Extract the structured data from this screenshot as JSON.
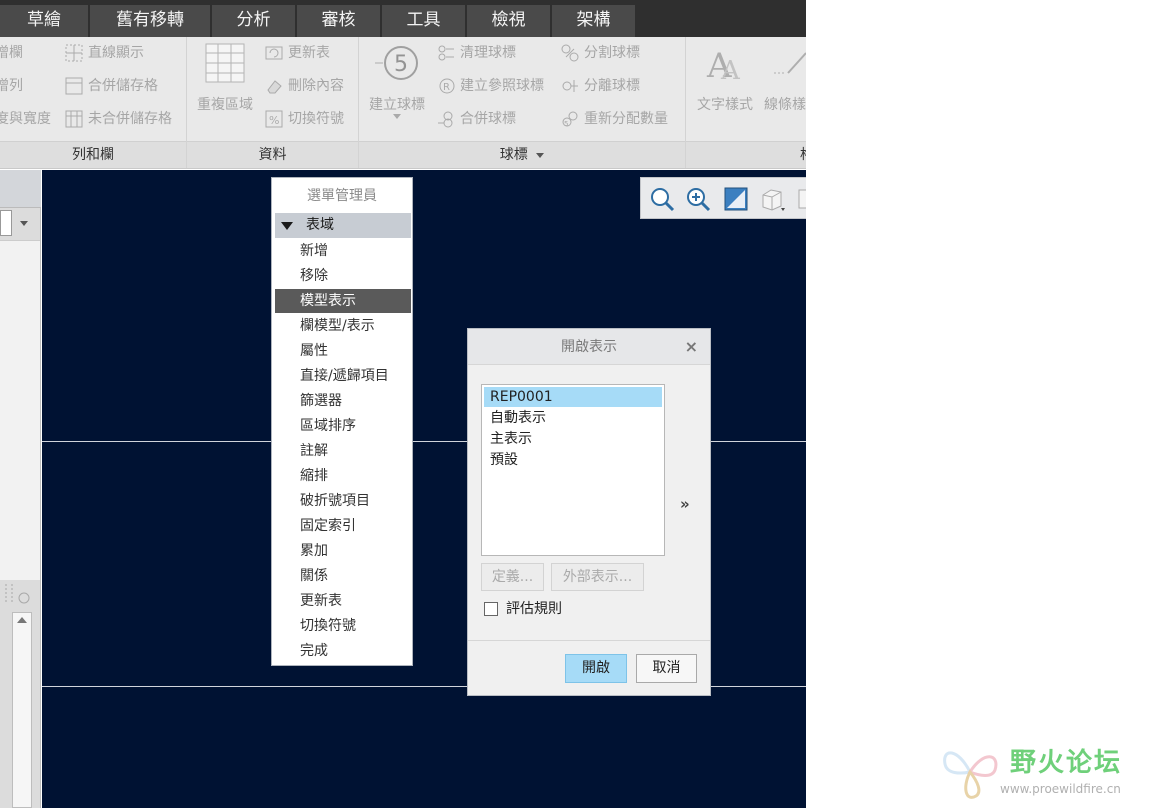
{
  "tabs": [
    {
      "label": "草繪"
    },
    {
      "label": "舊有移轉"
    },
    {
      "label": "分析"
    },
    {
      "label": "審核"
    },
    {
      "label": "工具"
    },
    {
      "label": "檢視"
    },
    {
      "label": "架構"
    }
  ],
  "ribbon": {
    "rows_cols": {
      "footer": "列和欄",
      "items": [
        "增欄",
        "增列",
        "度與寬度",
        "直線顯示",
        "合併儲存格",
        "未合併儲存格"
      ]
    },
    "data": {
      "footer": "資料",
      "big_button": "重複區域",
      "items": [
        "更新表",
        "刪除內容",
        "切換符號"
      ]
    },
    "balloons": {
      "footer": "球標",
      "big_button": "建立球標",
      "big_icon": "5",
      "items": [
        "清理球標",
        "建立參照球標",
        "合併球標",
        "分割球標",
        "分離球標",
        "重新分配數量"
      ]
    },
    "format": {
      "footer": "格",
      "items": [
        "文字樣式",
        "線條樣"
      ]
    }
  },
  "menu_manager": {
    "title": "選單管理員",
    "header": "表域",
    "selected_index": 2,
    "items": [
      "新增",
      "移除",
      "模型表示",
      "欄模型/表示",
      "屬性",
      "直接/遞歸項目",
      "篩選器",
      "區域排序",
      "註解",
      "縮排",
      "破折號項目",
      "固定索引",
      "累加",
      "關係",
      "更新表",
      "切換符號",
      "完成"
    ]
  },
  "dialog": {
    "title": "開啟表示",
    "close_icon": "×",
    "list_items": [
      "REP0001",
      "自動表示",
      "主表示",
      "預設"
    ],
    "selected_index": 0,
    "expand": "»",
    "define_button": "定義...",
    "external_button": "外部表示...",
    "checkbox_label": "評估規則",
    "checkbox_checked": false,
    "open_button": "開啟",
    "cancel_button": "取消"
  },
  "watermark": {
    "text": "野火论坛",
    "url": "www.proewildfire.cn"
  },
  "colors": {
    "graphics_bg": "#001233",
    "selection_blue": "#a6dbf7",
    "menu_selected": "#5a5a5a",
    "watermark_green": "#6fd07a"
  }
}
